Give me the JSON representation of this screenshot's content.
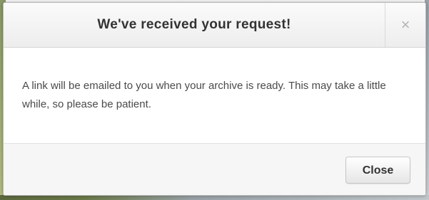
{
  "dialog": {
    "title": "We've received your request!",
    "close_icon_glyph": "×",
    "close_icon_name": "close-icon",
    "message": "A link will be emailed to you when your archive is ready. This may take a little while, so please be patient.",
    "close_button_label": "Close"
  },
  "colors": {
    "title_text": "#333333",
    "body_text": "#4a4a4a",
    "close_icon": "#b4b4b4",
    "footer_bg": "#f6f6f6",
    "border": "#b9b9b9"
  }
}
